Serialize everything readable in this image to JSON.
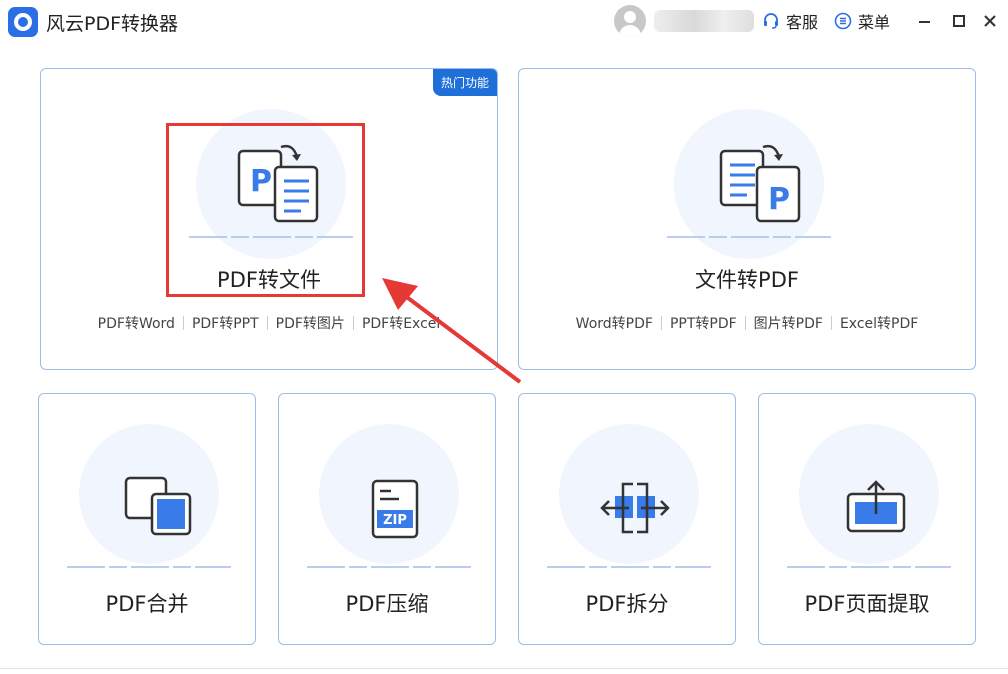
{
  "window": {
    "title": "风云PDF转换器",
    "service_label": "客服",
    "menu_label": "菜单"
  },
  "cards": {
    "pdf_to_file": {
      "title": "PDF转文件",
      "badge": "热门功能",
      "links": [
        "PDF转Word",
        "PDF转PPT",
        "PDF转图片",
        "PDF转Excel"
      ]
    },
    "file_to_pdf": {
      "title": "文件转PDF",
      "links": [
        "Word转PDF",
        "PPT转PDF",
        "图片转PDF",
        "Excel转PDF"
      ]
    },
    "merge": {
      "title": "PDF合并"
    },
    "compress": {
      "title": "PDF压缩",
      "icon_text": "ZIP"
    },
    "split": {
      "title": "PDF拆分"
    },
    "extract": {
      "title": "PDF页面提取"
    }
  },
  "colors": {
    "accent": "#1f6fd8",
    "icon_blue": "#3a7bea",
    "highlight": "#e53935"
  }
}
